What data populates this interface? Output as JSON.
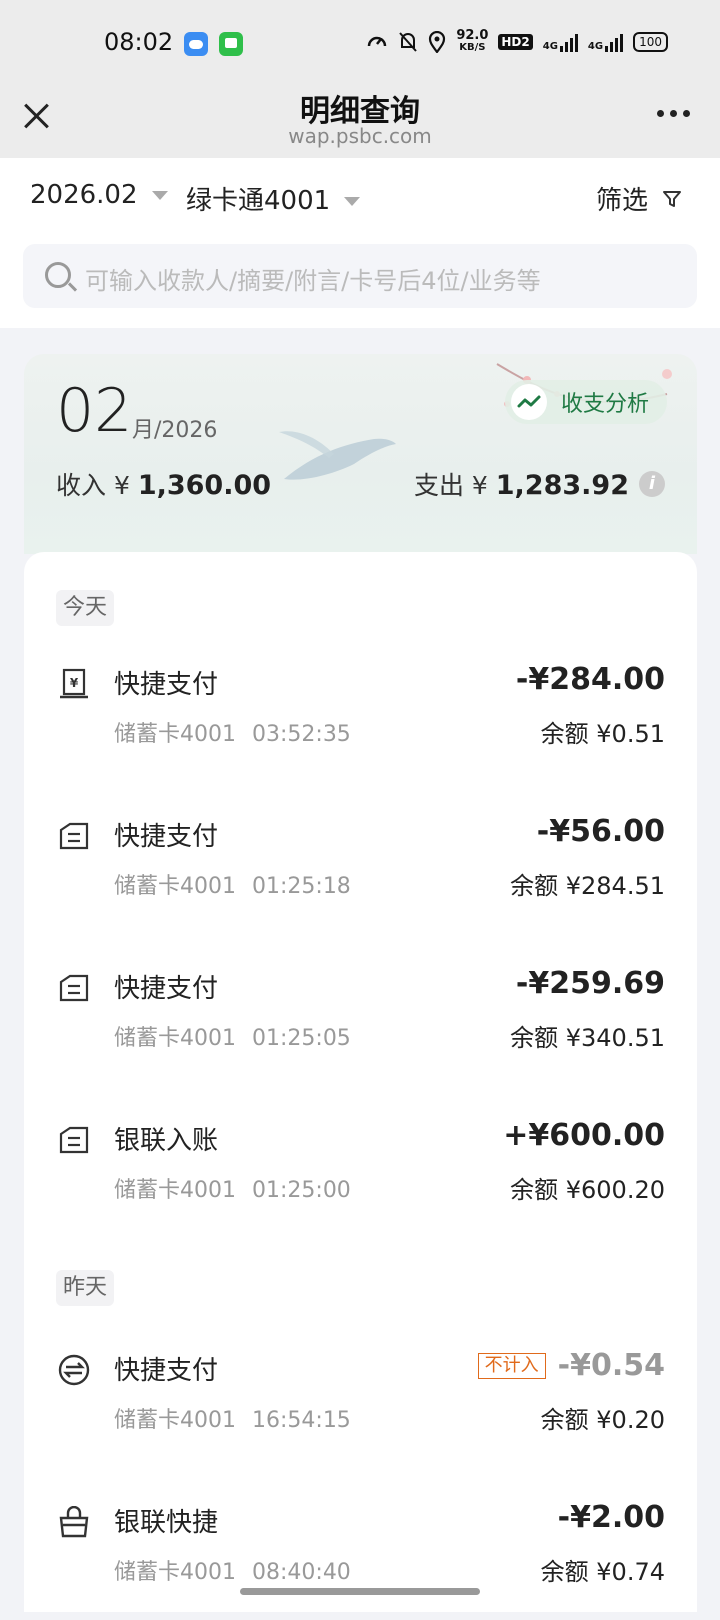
{
  "status_bar": {
    "time": "08:02",
    "speed_value": "92.0",
    "speed_unit": "KB/S",
    "hd": "HD2",
    "net1": "4G",
    "net2": "4G",
    "battery": "100"
  },
  "header": {
    "title": "明细查询",
    "subtitle": "wap.psbc.com"
  },
  "filters": {
    "month": "2026.02",
    "card": "绿卡通4001",
    "filter_label": "筛选"
  },
  "search": {
    "placeholder": "可输入收款人/摘要/附言/卡号后4位/业务等"
  },
  "summary": {
    "month_num": "02",
    "month_suffix": "月/2026",
    "analysis_label": "收支分析",
    "income_label": "收入 ¥",
    "income_value": "1,360.00",
    "expense_label": "支出 ¥",
    "expense_value": "1,283.92"
  },
  "groups": [
    {
      "label": "今天"
    },
    {
      "label": "昨天"
    }
  ],
  "transactions": [
    {
      "title": "快捷支付",
      "card": "储蓄卡4001",
      "time": "03:52:35",
      "amount": "-¥284.00",
      "balance": "余额 ¥0.51"
    },
    {
      "title": "快捷支付",
      "card": "储蓄卡4001",
      "time": "01:25:18",
      "amount": "-¥56.00",
      "balance": "余额 ¥284.51"
    },
    {
      "title": "快捷支付",
      "card": "储蓄卡4001",
      "time": "01:25:05",
      "amount": "-¥259.69",
      "balance": "余额 ¥340.51"
    },
    {
      "title": "银联入账",
      "card": "储蓄卡4001",
      "time": "01:25:00",
      "amount": "+¥600.00",
      "balance": "余额 ¥600.20"
    },
    {
      "title": "快捷支付",
      "card": "储蓄卡4001",
      "time": "16:54:15",
      "amount": "-¥0.54",
      "badge": "不计入",
      "balance": "余额 ¥0.20"
    },
    {
      "title": "银联快捷",
      "card": "储蓄卡4001",
      "time": "08:40:40",
      "amount": "-¥2.00",
      "balance": "余额 ¥0.74"
    }
  ]
}
